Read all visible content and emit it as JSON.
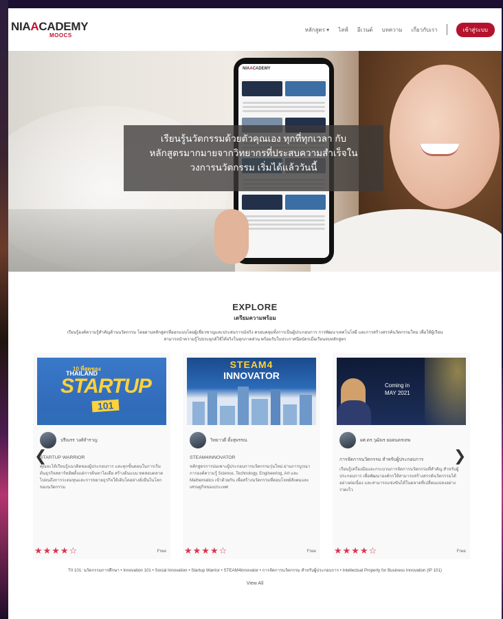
{
  "header": {
    "logo_left": "NIA",
    "logo_right": "CADEMY",
    "logo_sub": "MOOCS",
    "nav": [
      {
        "label": "หลักสูตร ▾"
      },
      {
        "label": "ไลฟ์"
      },
      {
        "label": "อีเวนต์"
      },
      {
        "label": "บทความ"
      },
      {
        "label": "เกี่ยวกับเรา"
      }
    ],
    "login_label": "เข้าสู่ระบบ"
  },
  "hero": {
    "caption_line1": "เรียนรู้นวัตกรรมด้วยตัวคุณเอง ทุกที่ทุกเวลา กับ",
    "caption_line2": "หลักสูตรมากมายจากวิทยากรที่ประสบความสำเร็จใน",
    "caption_line3": "วงการนวัตกรรม เริ่มได้แล้ววันนี้",
    "phone_logo_left": "NIA",
    "phone_logo_right": "CADEMY"
  },
  "explore": {
    "title": "EXPLORE",
    "subtitle": "เตรียมความพร้อม",
    "description": "เรียนรู้องค์ความรู้สำคัญด้านนวัตกรรม โดยผ่านหลักสูตรที่ออกแบบโดยผู้เชี่ยวชาญและประสบการณ์จริง ครอบคลุมทั้งการเป็นผู้ประกอบการ การพัฒนาเทคโนโลยี และการสร้างสรรค์นวัตกรรมใหม่ เพื่อให้ผู้เรียนสามารถนำความรู้ไปประยุกต์ใช้ได้จริงในทุกภาคส่วน พร้อมรับใบประกาศนียบัตรเมื่อเรียนจบหลักสูตร"
  },
  "cards": [
    {
      "img_line1": "10 ที่สุดของ",
      "img_line2": "THAILAND",
      "img_line3": "STARTUP",
      "img_line4": "101",
      "author": "ปรีณรร วงศ์สำราญ",
      "title": "STARTUP WARRIOR",
      "desc": "คุณจะได้เรียนรู้แนวคิดของผู้ประกอบการ และทุกขั้นตอนในการเริ่มต้นธุรกิจสตาร์ทอัพตั้งแต่การค้นหาไอเดีย สร้างต้นแบบ ทดสอบตลาด ไปจนถึงการระดมทุนและการขยายธุรกิจให้เติบโตอย่างยั่งยืนในโลกของนวัตกรรม",
      "stars": "★★★★☆",
      "price": "Free"
    },
    {
      "img_line1": "STEAM4",
      "img_line2": "INNOVATOR",
      "author": "วิทยาวดี ตั้งสุพรรณ",
      "title": "STEAM4INNOVATOR",
      "desc": "หลักสูตรการบ่มเพาะผู้ประกอบการนวัตกรรมรุ่นใหม่ ผ่านการบูรณาการองค์ความรู้ Science, Technology, Engineering, Art และ Mathematics เข้าด้วยกัน เพื่อสร้างนวัตกรรมที่ตอบโจทย์สังคมและเศรษฐกิจของประเทศ",
      "stars": "★★★★☆",
      "price": "Free"
    },
    {
      "img_line1": "Coming in",
      "img_line2": "MAY 2021",
      "author": "ผศ.ดร.วุฒิพร ยอดนครเทพ",
      "title": "การจัดการนวัตกรรม สำหรับผู้ประกอบการ",
      "desc": "เรียนรู้เครื่องมือและกระบวนการจัดการนวัตกรรมที่สำคัญ สำหรับผู้ประกอบการ เพื่อพัฒนาองค์กรให้สามารถสร้างสรรค์นวัตกรรมได้อย่างต่อเนื่อง และสามารถแข่งขันได้ในตลาดที่เปลี่ยนแปลงอย่างรวดเร็ว",
      "stars": "★★★★☆",
      "price": "Free"
    }
  ],
  "arrows": {
    "prev": "❮",
    "next": "❯"
  },
  "course_list": "TII 101: นวัตกรรมการศึกษา • Innovation 101 • Social Innovation • Startup Warrior • STEAM4Innovator • การจัดการนวัตกรรม สำหรับผู้ประกอบการ • Intellectual Property for Business Innovation (IP 101)",
  "view_all": "View All"
}
